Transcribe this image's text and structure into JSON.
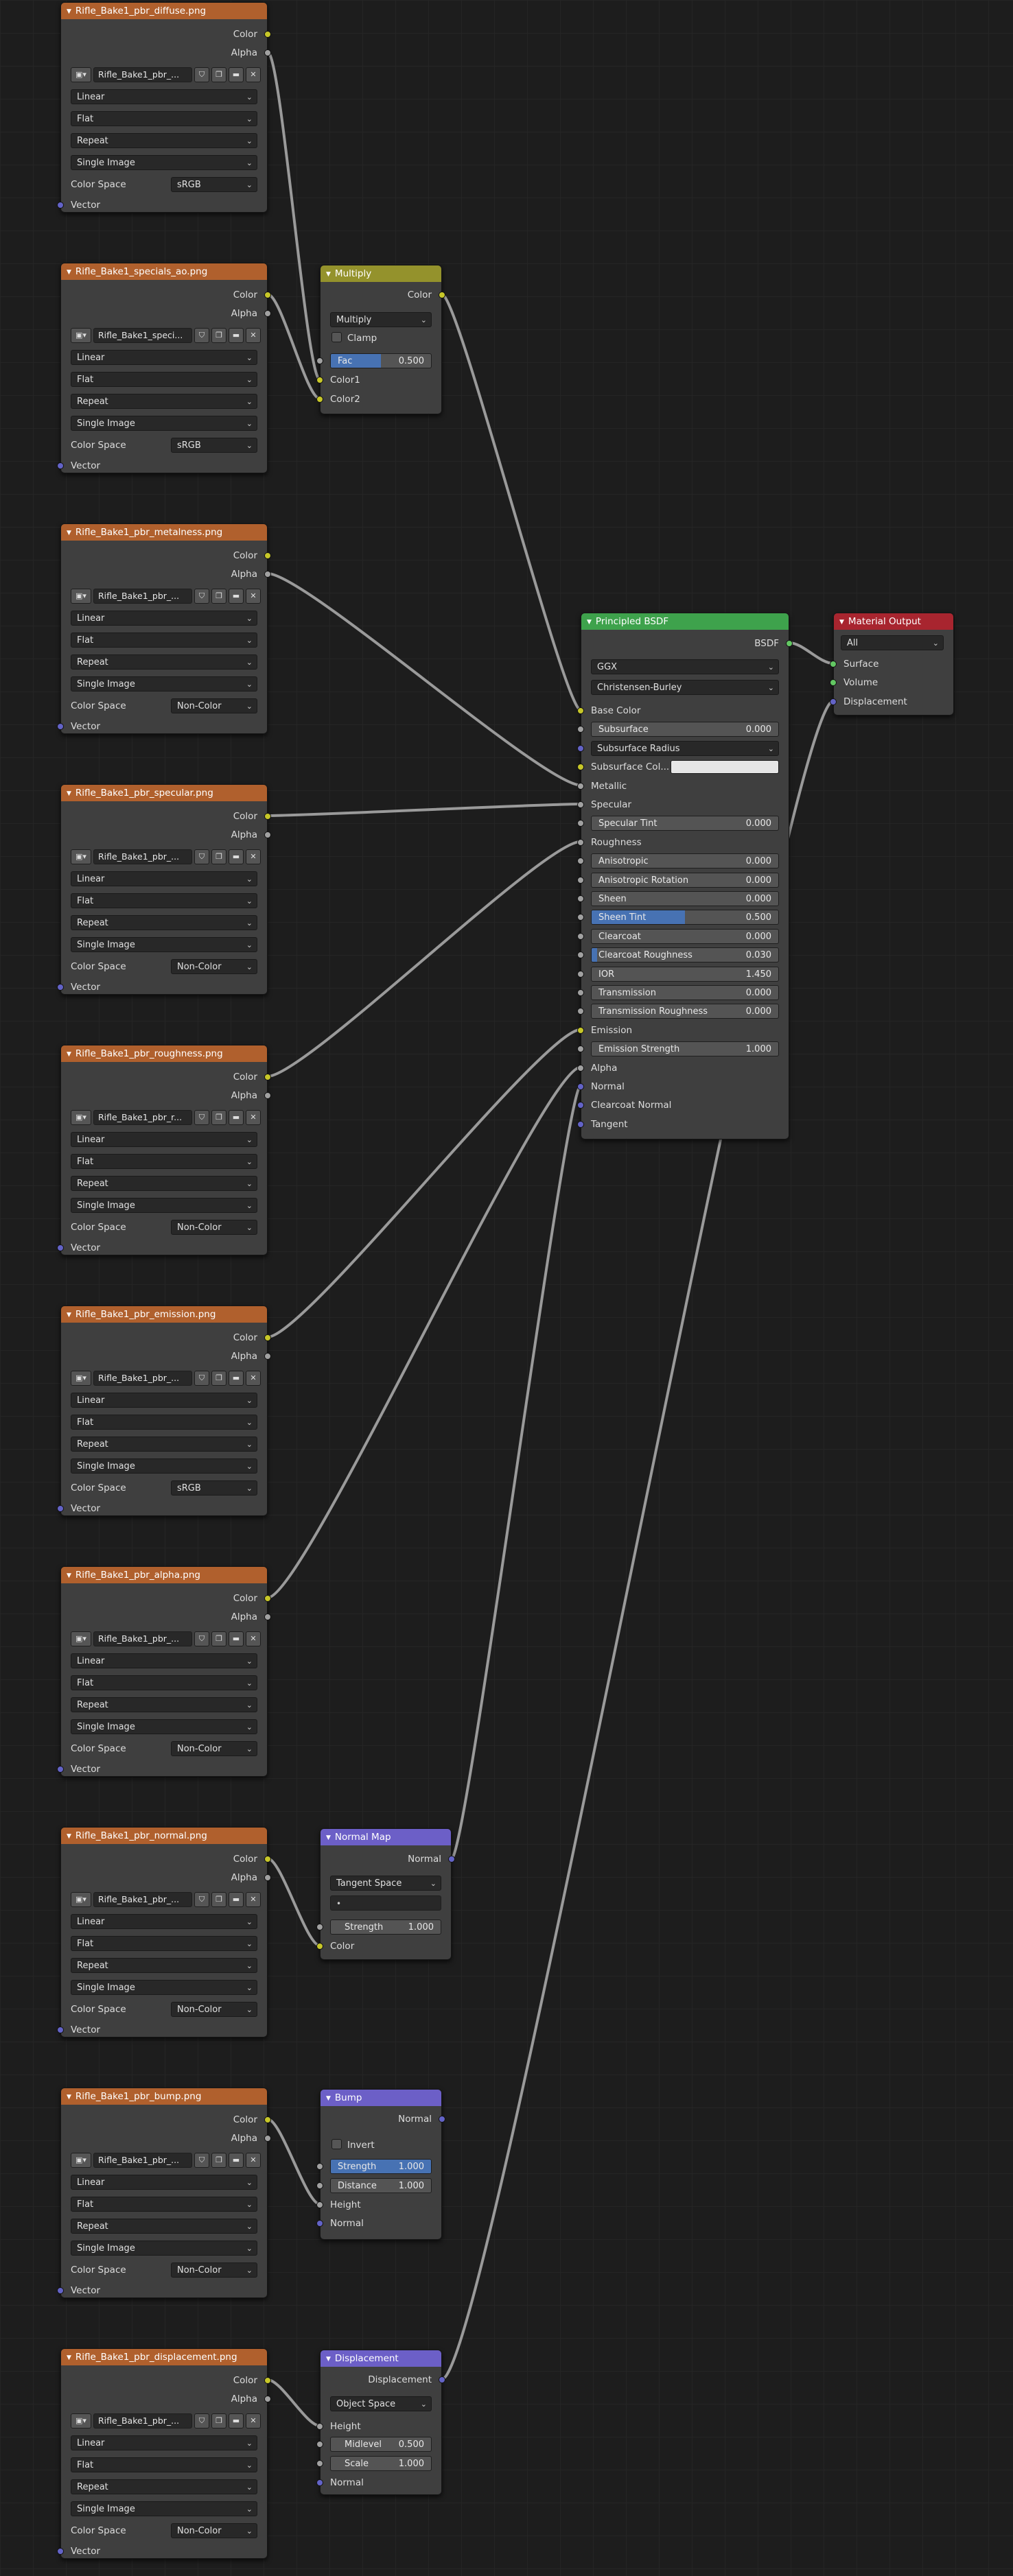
{
  "colors": {
    "texture_header": "#b0602d",
    "converter_header": "#94922c",
    "vector_header": "#6c5fc7",
    "shader_header": "#3ea24c",
    "output_header": "#a8252f",
    "socket_color": "#c7c729",
    "socket_float": "#a1a1a1",
    "socket_vector": "#6363c7",
    "socket_shader": "#63c763",
    "slider_fill": "#4772b3",
    "link": "#9a9a9a"
  },
  "image_texture_common": {
    "out_color": "Color",
    "out_alpha": "Alpha",
    "interpolation": "Linear",
    "projection": "Flat",
    "extension": "Repeat",
    "source": "Single Image",
    "color_space_label": "Color Space",
    "in_vector": "Vector",
    "icons": [
      "image-icon",
      "shield-icon",
      "duplicate-icon",
      "folder-icon",
      "close-icon"
    ]
  },
  "textures": [
    {
      "title": "Rifle_Bake1_pbr_diffuse.png",
      "image_name": "Rifle_Bake1_pbr_...",
      "color_space": "sRGB"
    },
    {
      "title": "Rifle_Bake1_specials_ao.png",
      "image_name": "Rifle_Bake1_speci...",
      "color_space": "sRGB"
    },
    {
      "title": "Rifle_Bake1_pbr_metalness.png",
      "image_name": "Rifle_Bake1_pbr_...",
      "color_space": "Non-Color"
    },
    {
      "title": "Rifle_Bake1_pbr_specular.png",
      "image_name": "Rifle_Bake1_pbr_...",
      "color_space": "Non-Color"
    },
    {
      "title": "Rifle_Bake1_pbr_roughness.png",
      "image_name": "Rifle_Bake1_pbr_r...",
      "color_space": "Non-Color"
    },
    {
      "title": "Rifle_Bake1_pbr_emission.png",
      "image_name": "Rifle_Bake1_pbr_...",
      "color_space": "sRGB"
    },
    {
      "title": "Rifle_Bake1_pbr_alpha.png",
      "image_name": "Rifle_Bake1_pbr_...",
      "color_space": "Non-Color"
    },
    {
      "title": "Rifle_Bake1_pbr_normal.png",
      "image_name": "Rifle_Bake1_pbr_...",
      "color_space": "Non-Color"
    },
    {
      "title": "Rifle_Bake1_pbr_bump.png",
      "image_name": "Rifle_Bake1_pbr_...",
      "color_space": "Non-Color"
    },
    {
      "title": "Rifle_Bake1_pbr_displacement.png",
      "image_name": "Rifle_Bake1_pbr_...",
      "color_space": "Non-Color"
    }
  ],
  "multiply": {
    "title": "Multiply",
    "out_color": "Color",
    "blend_mode": "Multiply",
    "clamp_label": "Clamp",
    "fac_label": "Fac",
    "fac_value": "0.500",
    "fac_fraction": 0.5,
    "in_color1": "Color1",
    "in_color2": "Color2"
  },
  "bsdf": {
    "title": "Principled BSDF",
    "out_bsdf": "BSDF",
    "distribution": "GGX",
    "subsurface_method": "Christensen-Burley",
    "inputs": [
      {
        "label": "Base Color",
        "kind": "socket",
        "socket": "yellow"
      },
      {
        "label": "Subsurface",
        "kind": "slider",
        "value": "0.000",
        "fraction": 0,
        "socket": "grey"
      },
      {
        "label": "Subsurface Radius",
        "kind": "dropdown",
        "socket": "purple"
      },
      {
        "label": "Subsurface Col...",
        "kind": "color",
        "socket": "yellow"
      },
      {
        "label": "Metallic",
        "kind": "socket",
        "socket": "grey"
      },
      {
        "label": "Specular",
        "kind": "socket",
        "socket": "grey"
      },
      {
        "label": "Specular Tint",
        "kind": "slider",
        "value": "0.000",
        "fraction": 0,
        "socket": "grey"
      },
      {
        "label": "Roughness",
        "kind": "socket",
        "socket": "grey"
      },
      {
        "label": "Anisotropic",
        "kind": "slider",
        "value": "0.000",
        "fraction": 0,
        "socket": "grey"
      },
      {
        "label": "Anisotropic Rotation",
        "kind": "slider",
        "value": "0.000",
        "fraction": 0,
        "socket": "grey"
      },
      {
        "label": "Sheen",
        "kind": "slider",
        "value": "0.000",
        "fraction": 0,
        "socket": "grey"
      },
      {
        "label": "Sheen Tint",
        "kind": "slider",
        "value": "0.500",
        "fraction": 0.5,
        "socket": "grey"
      },
      {
        "label": "Clearcoat",
        "kind": "slider",
        "value": "0.000",
        "fraction": 0,
        "socket": "grey"
      },
      {
        "label": "Clearcoat Roughness",
        "kind": "slider",
        "value": "0.030",
        "fraction": 0.03,
        "socket": "grey"
      },
      {
        "label": "IOR",
        "kind": "slider",
        "value": "1.450",
        "fraction": 0,
        "socket": "grey"
      },
      {
        "label": "Transmission",
        "kind": "slider",
        "value": "0.000",
        "fraction": 0,
        "socket": "grey"
      },
      {
        "label": "Transmission Roughness",
        "kind": "slider",
        "value": "0.000",
        "fraction": 0,
        "socket": "grey"
      },
      {
        "label": "Emission",
        "kind": "socket",
        "socket": "yellow"
      },
      {
        "label": "Emission Strength",
        "kind": "slider",
        "value": "1.000",
        "fraction": 0,
        "socket": "grey"
      },
      {
        "label": "Alpha",
        "kind": "socket",
        "socket": "grey"
      },
      {
        "label": "Normal",
        "kind": "socket",
        "socket": "purple"
      },
      {
        "label": "Clearcoat Normal",
        "kind": "socket",
        "socket": "purple"
      },
      {
        "label": "Tangent",
        "kind": "socket",
        "socket": "purple"
      }
    ]
  },
  "material_output": {
    "title": "Material Output",
    "target": "All",
    "in_surface": "Surface",
    "in_volume": "Volume",
    "in_displacement": "Displacement"
  },
  "normal_map": {
    "title": "Normal Map",
    "out_normal": "Normal",
    "space": "Tangent Space",
    "uv_placeholder": "",
    "strength_label": "Strength",
    "strength_value": "1.000",
    "in_color": "Color"
  },
  "bump": {
    "title": "Bump",
    "out_normal": "Normal",
    "invert_label": "Invert",
    "strength_label": "Strength",
    "strength_value": "1.000",
    "strength_fraction": 1,
    "distance_label": "Distance",
    "distance_value": "1.000",
    "in_height": "Height",
    "in_normal": "Normal"
  },
  "displacement": {
    "title": "Displacement",
    "out_displacement": "Displacement",
    "space": "Object Space",
    "in_height": "Height",
    "midlevel_label": "Midlevel",
    "midlevel_value": "0.500",
    "scale_label": "Scale",
    "scale_value": "1.000",
    "in_normal": "Normal"
  }
}
